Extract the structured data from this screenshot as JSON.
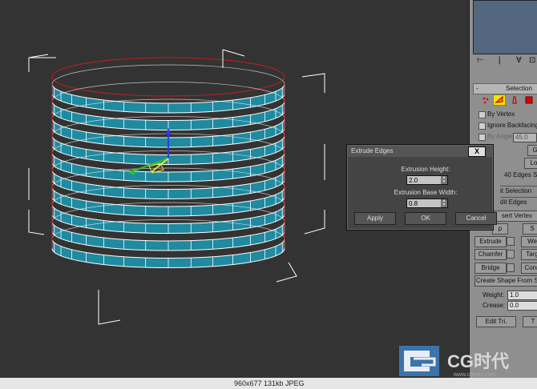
{
  "viewport": {
    "wire_color": "#ffffff",
    "mesh_fill": "#1f8aa0",
    "mesh_edge": "#ffffff",
    "selection_ring_color": "#c41e1e",
    "gizmo_axes": [
      "z-axis-blue",
      "y-axis-green",
      "x-axis-yellow"
    ]
  },
  "command_panel": {
    "toolbar_icons": [
      "hierarchy-icon",
      "pin-icon",
      "modifier-stack-icon",
      "display-icon"
    ],
    "selection_rollout": {
      "collapse": "-",
      "title": "Selection"
    },
    "subobject_icons": [
      "vertex-icon",
      "edge-icon",
      "border-icon",
      "polygon-icon"
    ],
    "checks": [
      "By Vertex",
      "Ignore Backfacing",
      "By Angle:"
    ],
    "angle_value": "45.0",
    "grow_label": "Gr",
    "loop_label": "Lo",
    "status": "40 Edges S",
    "edit_selection": "it Selection",
    "edit_edges": "dit Edges",
    "insert_vertex": "sert Vertex",
    "remove": "p",
    "split": "S",
    "buttons": {
      "extrude": "Extrude",
      "weld": "We",
      "chamfer": "Chamfer",
      "target_weld": "Targ",
      "bridge": "Bridge",
      "connect": "Conn",
      "create_shape": "Create Shape From Se",
      "edit_tri": "Edit Tri.",
      "turn": "T"
    },
    "weight_label": "Weight:",
    "weight_value": "1.0",
    "crease_label": "Crease:",
    "crease_value": "0.0"
  },
  "dialog": {
    "title": "Extrude Edges",
    "close": "X",
    "height_label": "Extrusion Height:",
    "height_value": "2.0",
    "width_label": "Extrusion Base Width:",
    "width_value": "0.8",
    "apply": "Apply",
    "ok": "OK",
    "cancel": "Cancel"
  },
  "status_bar": {
    "text": "960x677  131kb  JPEG"
  },
  "watermark": {
    "text": "CG时代",
    "url_text": "www.cgtime.com"
  }
}
